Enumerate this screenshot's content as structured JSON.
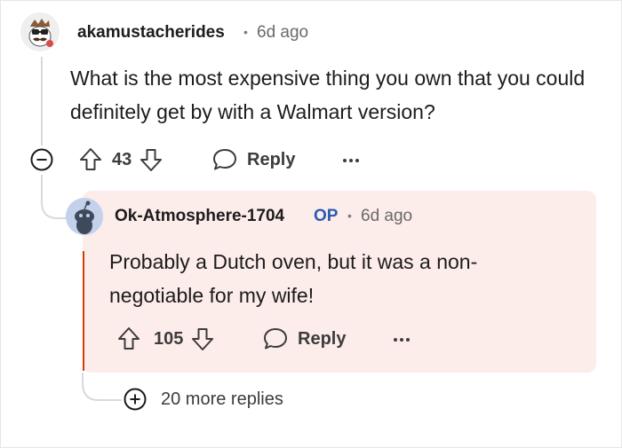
{
  "comment": {
    "author": "akamustacherides",
    "time": "6d ago",
    "body": "What is the most expensive thing you own that you could definitely get by with a Walmart version?",
    "votes": "43",
    "reply_label": "Reply"
  },
  "reply": {
    "author": "Ok-Atmosphere-1704",
    "op_tag": "OP",
    "time": "6d ago",
    "body": "Probably a Dutch oven, but it was a non-negotiable for my wife!",
    "votes": "105",
    "reply_label": "Reply"
  },
  "more_replies": "20 more replies",
  "colors": {
    "accent_op": "#2a5db0",
    "highlight_bg": "#fcecea",
    "highlight_border": "#d93a00"
  },
  "icons": [
    "collapse-icon",
    "upvote-icon",
    "downvote-icon",
    "comment-bubble-icon",
    "more-options-icon",
    "reddit-snoo-avatar",
    "expand-plus-icon"
  ]
}
